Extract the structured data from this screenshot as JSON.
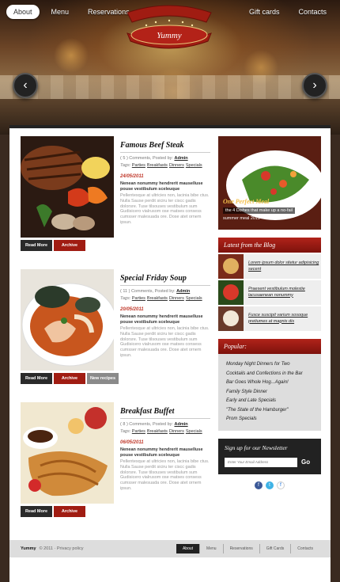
{
  "nav": {
    "left": [
      "About",
      "Menu",
      "Reservations"
    ],
    "right": [
      "Gift cards",
      "Contacts"
    ]
  },
  "logo": {
    "text": "Yummy"
  },
  "slider": {
    "prev": "‹",
    "next": "›"
  },
  "posts": [
    {
      "title": "Famous Beef Steak",
      "comments": "( 5 ) Comments, Posted by:",
      "author": "Admin",
      "tags_label": "Tags:",
      "tags": [
        "Parties",
        "Breakfasts",
        "Dinners",
        "Specials"
      ],
      "date": "24/05/2011",
      "lead": "Nenean nonummy hendrerit mauselluse pouse vestibulum sceleuque",
      "text": "Pellentesque at ultricies non, lacinia bibe ctus. Nulla Sause perdit siciru ter ciscc gadis dolorsre. Tuse tilsouses vestibulum sum Gudisicero vialrusom ose matses consess cumsser malesuada ore. Dose atet ornem ipsun.",
      "buttons": [
        "Read More",
        "Archive"
      ]
    },
    {
      "title": "Special Friday Soup",
      "comments": "( 11 ) Comments, Posted by:",
      "author": "Admin",
      "tags_label": "Tags:",
      "tags": [
        "Parties",
        "Breakfasts",
        "Dinners",
        "Specials"
      ],
      "date": "20/05/2011",
      "lead": "Nenean nonummy hendrerit mauselluse pouse vestibulum sceleuque",
      "text": "Pellentesque at ultricies non, lacinia bibe ctus. Nulla Sause perdit siciru ter ciscc gadis dolorsre. Tuse tilsouses vestibulum sum Gudisicero vialrusom ose matses consess cumsser malesuada ore. Dose atet ornem ipsun.",
      "buttons": [
        "Read More",
        "Archive",
        "New recipes"
      ]
    },
    {
      "title": "Breakfast Buffet",
      "comments": "( 8 ) Comments, Posted by:",
      "author": "Admin",
      "tags_label": "Tags:",
      "tags": [
        "Parties",
        "Breakfasts",
        "Dinners",
        "Specials"
      ],
      "date": "06/05/2011",
      "lead": "Nenean nonummy hendrerit mauselluse pouse vestibulum sceleuque",
      "text": "Pellentesque at ultricies non, lacinia bibe ctus. Nulla Sause perdit siciru ter ciscc gadis dolorsre. Tuse tilsouses vestibulum sum Gudisicero vialrusom ose matses consess cumsser malesuada ore. Dose atet ornem ipsun.",
      "buttons": [
        "Read More",
        "Archive"
      ]
    }
  ],
  "featured": {
    "line1": "One Perfect Meal",
    "line2": "the 4 Dishes that make up a no-fail",
    "line3": "summer meal 2011"
  },
  "blog": {
    "title": "Latest from the Blog",
    "items": [
      "Lorem ipsum dolor sitetur adipisicing secent",
      "Praesent vestibulum molestie lacusaenean nonummy",
      "Fusce suscipit varium sosoque pretiumes at magnis dis"
    ]
  },
  "popular": {
    "title": "Popular:",
    "items": [
      "Monday Night Dinners for Two",
      "Cocktails and Confections in the Bar",
      "Bar Goes Whole Hog...Again!",
      "Family Style Dinner",
      "Early and Late Specials",
      "\"The State of the Hamburger\"",
      "Prom Specials"
    ]
  },
  "newsletter": {
    "title": "Sign up for our Newsletter",
    "placeholder": "Enter Your Email Address",
    "go": "Go"
  },
  "social": [
    "f",
    "t",
    "f"
  ],
  "footer": {
    "brand": "Yummy",
    "copy": "© 2011 · Privacy policy",
    "links": [
      "About",
      "Menu",
      "Reservations",
      "Gift Cards",
      "Contacts"
    ]
  },
  "colors": {
    "accent": "#a01c12",
    "dark": "#222222",
    "date": "#c0392b"
  }
}
